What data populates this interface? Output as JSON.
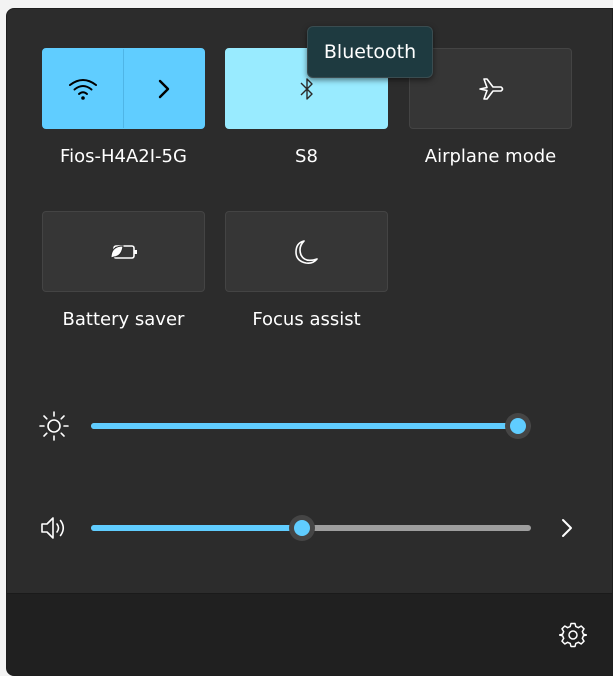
{
  "quick_settings": {
    "tiles": [
      {
        "id": "wifi",
        "label": "Fios-H4A2I-5G",
        "state": "on",
        "icon": "wifi-icon",
        "has_chevron": true
      },
      {
        "id": "bluetooth",
        "label": "S8",
        "state": "on-hover",
        "icon": "bluetooth-icon"
      },
      {
        "id": "airplane",
        "label": "Airplane mode",
        "state": "off",
        "icon": "airplane-icon"
      },
      {
        "id": "battery_saver",
        "label": "Battery saver",
        "state": "off",
        "icon": "battery-saver-icon"
      },
      {
        "id": "focus_assist",
        "label": "Focus assist",
        "state": "off",
        "icon": "moon-icon"
      }
    ],
    "tooltip": "Bluetooth"
  },
  "sliders": {
    "brightness": {
      "icon": "sun-icon",
      "value_percent": 97
    },
    "volume": {
      "icon": "speaker-icon",
      "value_percent": 48
    }
  },
  "footer": {
    "settings_icon": "gear-icon"
  },
  "colors": {
    "accent": "#60cdff",
    "accent_light": "#99ebff",
    "panel_bg": "#2c2c2c",
    "footer_bg": "#202020",
    "tile_off": "#363636"
  }
}
